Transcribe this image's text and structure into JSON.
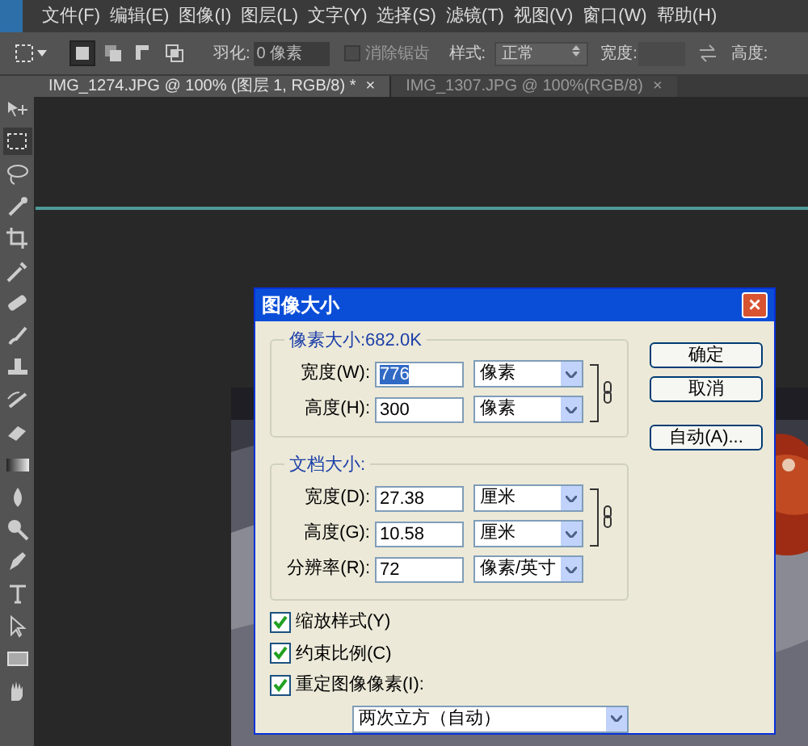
{
  "menu_bar": {
    "items": [
      "文件(F)",
      "编辑(E)",
      "图像(I)",
      "图层(L)",
      "文字(Y)",
      "选择(S)",
      "滤镜(T)",
      "视图(V)",
      "窗口(W)",
      "帮助(H)"
    ]
  },
  "options_bar": {
    "modes": [
      {
        "selected": true
      },
      {
        "selected": false
      },
      {
        "selected": false
      },
      {
        "selected": false
      }
    ],
    "feather_label": "羽化:",
    "feather_value": "0 像素",
    "antialias": {
      "label": "消除锯齿",
      "checked": false
    },
    "style_label": "样式:",
    "style_value": "正常",
    "width_label": "宽度:",
    "height_label": "高度:"
  },
  "document_tabs": [
    {
      "title": "IMG_1274.JPG @ 100% (图层 1, RGB/8) *",
      "close": "×",
      "selected": true
    },
    {
      "title": "IMG_1307.JPG @ 100%(RGB/8)",
      "close": "×",
      "selected": false
    }
  ],
  "tools": [
    {
      "kind": "move",
      "selected": false
    },
    {
      "kind": "marquee",
      "selected": true
    },
    {
      "kind": "lasso",
      "selected": false
    },
    {
      "kind": "quick_select",
      "selected": false
    },
    {
      "kind": "crop",
      "selected": false
    },
    {
      "kind": "eyedropper",
      "selected": false
    },
    {
      "kind": "healing",
      "selected": false
    },
    {
      "kind": "brush",
      "selected": false
    },
    {
      "kind": "stamp",
      "selected": false
    },
    {
      "kind": "history_brush",
      "selected": false
    },
    {
      "kind": "eraser",
      "selected": false
    },
    {
      "kind": "gradient",
      "selected": false
    },
    {
      "kind": "blur",
      "selected": false
    },
    {
      "kind": "dodge",
      "selected": false
    },
    {
      "kind": "pen",
      "selected": false
    },
    {
      "kind": "type",
      "selected": false
    },
    {
      "kind": "path_select",
      "selected": false
    },
    {
      "kind": "shape",
      "selected": false
    },
    {
      "kind": "hand",
      "selected": false
    }
  ],
  "dialog": {
    "title": "图像大小",
    "close": "×",
    "pixel_group": {
      "title": "像素大小:682.0K",
      "rows": [
        {
          "label": "宽度(W):",
          "value": "776",
          "text_selected": true,
          "unit": "像素",
          "linked": true
        },
        {
          "label": "高度(H):",
          "value": "300",
          "text_selected": false,
          "unit": "像素",
          "linked": true
        }
      ]
    },
    "document_group": {
      "title": "文档大小:",
      "rows": [
        {
          "label": "宽度(D):",
          "value": "27.38",
          "text_selected": false,
          "unit": "厘米",
          "linked": true
        },
        {
          "label": "高度(G):",
          "value": "10.58",
          "text_selected": false,
          "unit": "厘米",
          "linked": true
        },
        {
          "label": "分辨率(R):",
          "value": "72",
          "text_selected": false,
          "unit": "像素/英寸"
        }
      ]
    },
    "buttons": [
      "确定",
      "取消",
      "自动(A)..."
    ],
    "checkboxes": [
      {
        "label": "缩放样式(Y)",
        "checked": true
      },
      {
        "label": "约束比例(C)",
        "checked": true
      },
      {
        "label": "重定图像像素(I):",
        "checked": true
      }
    ],
    "resample": "两次立方（自动）"
  }
}
